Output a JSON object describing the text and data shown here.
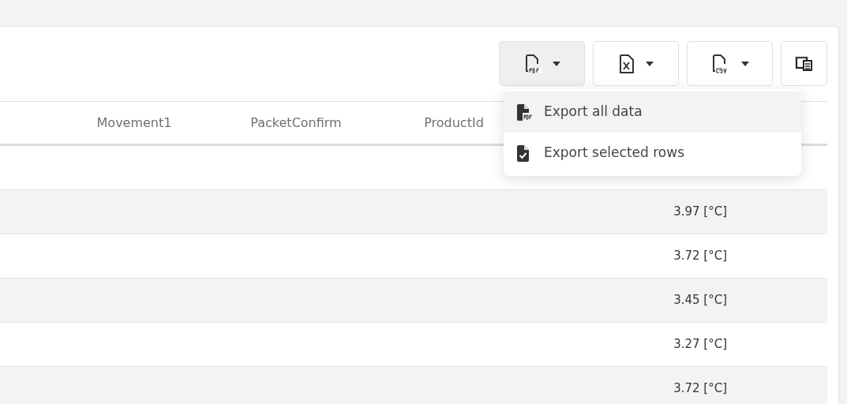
{
  "toolbar": {
    "buttons": [
      {
        "kind": "pdf",
        "expanded": true
      },
      {
        "kind": "excel",
        "expanded": false
      },
      {
        "kind": "csv",
        "expanded": false
      },
      {
        "kind": "columns",
        "expanded": false
      }
    ]
  },
  "export_menu": {
    "items": [
      {
        "kind": "pdf",
        "label": "Export all data",
        "selected": true
      },
      {
        "kind": "check",
        "label": "Export selected rows",
        "selected": false
      }
    ]
  },
  "table": {
    "columns": [
      "",
      "Movement1",
      "PacketConfirm",
      "ProductId",
      ""
    ],
    "rows": [
      {
        "column_5": ""
      },
      {
        "column_5": "3.97 [°C]"
      },
      {
        "column_5": "3.72 [°C]"
      },
      {
        "column_5": "3.45 [°C]"
      },
      {
        "column_5": "3.27 [°C]"
      },
      {
        "column_5": "3.72 [°C]"
      }
    ]
  }
}
